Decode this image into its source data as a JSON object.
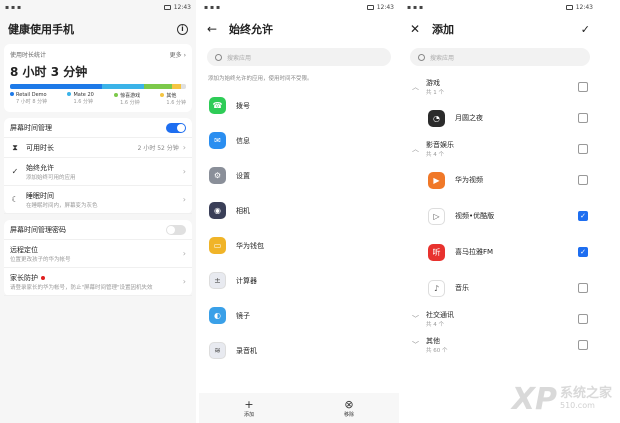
{
  "status_bar": {
    "time": "12:43"
  },
  "screen1": {
    "title": "健康使用手机",
    "stats_label": "使用时长统计",
    "more": "更多",
    "total": "8 小时 3 分钟",
    "usage_bar": [
      {
        "fraction": 0.52,
        "color": "#1e7ae8"
      },
      {
        "fraction": 0.24,
        "color": "#3bb3e8"
      },
      {
        "fraction": 0.16,
        "color": "#7cc94a"
      },
      {
        "fraction": 0.05,
        "color": "#f5c542"
      },
      {
        "fraction": 0.03,
        "color": "#e0e0e0"
      }
    ],
    "legend": [
      {
        "name": "Retail Demo",
        "time": "7 小时 8 分钟",
        "color": "#1e7ae8"
      },
      {
        "name": "Mate 20",
        "time": "1.6 分钟",
        "color": "#3bb3e8"
      },
      {
        "name": "惊喜游戏",
        "time": "1.6 分钟",
        "color": "#7cc94a"
      },
      {
        "name": "其他",
        "time": "1.6 分钟",
        "color": "#f5c542"
      }
    ],
    "screen_time_mgmt": "屏幕时间管理",
    "available": {
      "label": "可用时长",
      "value": "2 小时 52 分钟"
    },
    "always_allow": {
      "label": "始终允许",
      "sub": "添加始终可用的应用"
    },
    "bedtime": {
      "label": "睡眠时间",
      "sub": "在睡眠时间内，屏幕变为灰色"
    },
    "password": "屏幕时间管理密码",
    "remote": {
      "label": "远程定位",
      "sub": "位置更改孩子的华为帐号"
    },
    "parental": {
      "label": "家长防护",
      "sub": "请登录家长的华为帐号，防止\"屏幕时间管理\"设置因机失效"
    }
  },
  "screen2": {
    "title": "始终允许",
    "search_placeholder": "搜索应用",
    "note": "添加为始终允许的应用，使用时间不受限。",
    "apps": [
      {
        "name": "拨号",
        "icon": "phone-icon",
        "color": "#2ecc57"
      },
      {
        "name": "信息",
        "icon": "message-icon",
        "color": "#2a8ef0"
      },
      {
        "name": "设置",
        "icon": "gear-icon",
        "color": "#8a8f99"
      },
      {
        "name": "相机",
        "icon": "camera-icon",
        "color": "#3a3f58"
      },
      {
        "name": "华为钱包",
        "icon": "wallet-icon",
        "color": "#f0b428"
      },
      {
        "name": "计算器",
        "icon": "calculator-icon",
        "color": "#e8eaf0"
      },
      {
        "name": "镜子",
        "icon": "mirror-icon",
        "color": "#3aa0e8"
      },
      {
        "name": "录音机",
        "icon": "recorder-icon",
        "color": "#e8eaf0"
      }
    ],
    "add": "添加",
    "remove": "移除"
  },
  "screen3": {
    "title": "添加",
    "search_placeholder": "搜索应用",
    "groups": [
      {
        "name": "游戏",
        "count": "共 1 个",
        "apps": [
          {
            "name": "月圆之夜",
            "icon": "moon-game-icon",
            "color": "#2b2b2b",
            "checked": false
          }
        ]
      },
      {
        "name": "影音娱乐",
        "count": "共 4 个",
        "apps": [
          {
            "name": "华为视频",
            "icon": "video-icon",
            "color": "#f07828",
            "checked": false
          },
          {
            "name": "视频•优酷版",
            "icon": "youku-icon",
            "color": "#ffffff",
            "checked": true
          },
          {
            "name": "喜马拉雅FM",
            "icon": "ximalaya-icon",
            "color": "#e8322e",
            "checked": true
          },
          {
            "name": "音乐",
            "icon": "music-icon",
            "color": "#ffffff",
            "checked": false
          }
        ]
      },
      {
        "name": "社交通讯",
        "count": "共 4 个",
        "apps": []
      },
      {
        "name": "其他",
        "count": "共 60 个",
        "apps": []
      }
    ]
  },
  "watermark": {
    "brand": "XP",
    "sub": "510.com",
    "cn": "系统之家"
  }
}
